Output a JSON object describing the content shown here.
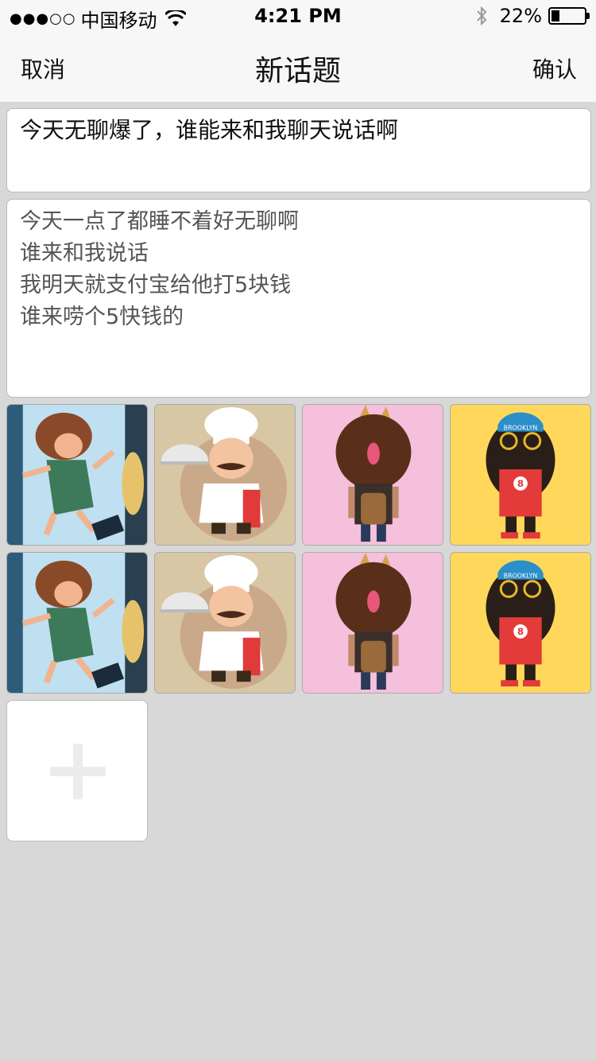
{
  "status_bar": {
    "signal_dots": "●●●○○",
    "carrier": "中国移动",
    "time": "4:21 PM",
    "battery_percent": "22%",
    "battery_level": 0.22
  },
  "nav": {
    "cancel_label": "取消",
    "title": "新话题",
    "confirm_label": "确认"
  },
  "topic_title": "今天无聊爆了，谁能来和我聊天说话啊",
  "topic_body": [
    "今天一点了都睡不着好无聊啊",
    "谁来和我说话",
    "我明天就支付宝给他打5块钱",
    "谁来唠个5快钱的"
  ],
  "images": [
    {
      "kind": "sleeping-girl",
      "bg": "#bfe0f0"
    },
    {
      "kind": "chef",
      "bg": "#d8c7a5"
    },
    {
      "kind": "curly-hair-person",
      "bg": "#f5c0dc"
    },
    {
      "kind": "basketball-player",
      "bg": "#ffd85b"
    },
    {
      "kind": "sleeping-girl",
      "bg": "#bfe0f0"
    },
    {
      "kind": "chef",
      "bg": "#d8c7a5"
    },
    {
      "kind": "curly-hair-person",
      "bg": "#f5c0dc"
    },
    {
      "kind": "basketball-player",
      "bg": "#ffd85b"
    }
  ],
  "basketball_player": {
    "jersey_number": "8",
    "cap_text": "BROOKLYN"
  },
  "add_button_icon": "plus-icon"
}
